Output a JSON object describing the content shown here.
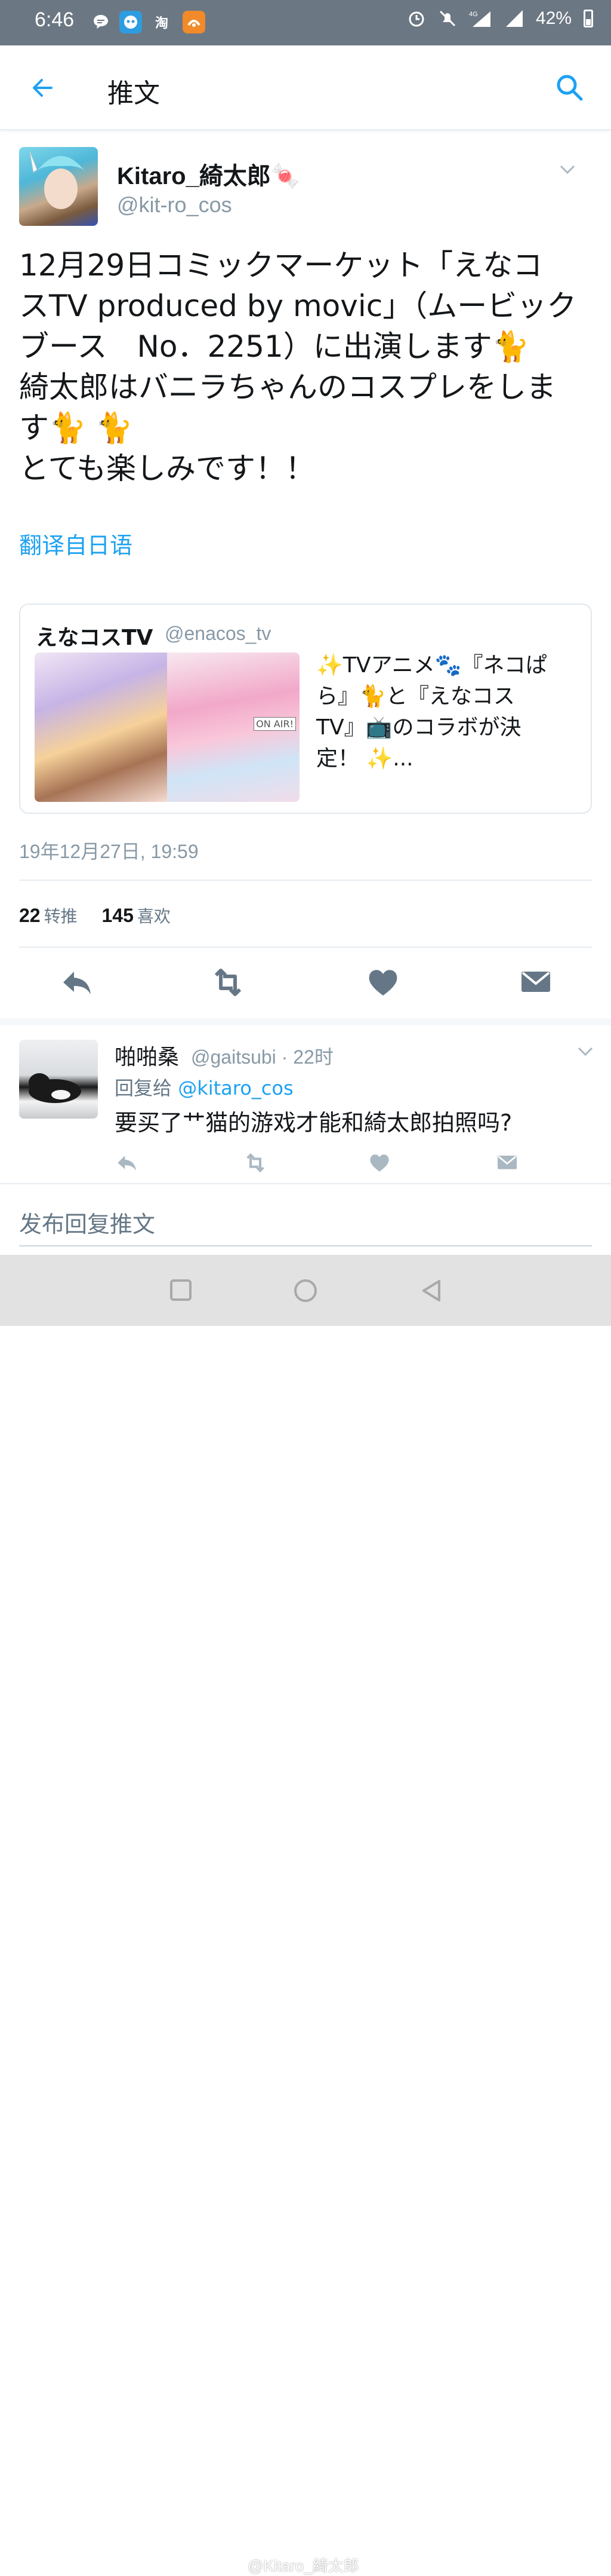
{
  "status_bar": {
    "time": "6:46",
    "app_icons": [
      "message-icon",
      "bot-icon",
      "taobao-icon",
      "uc-icon"
    ],
    "taobao_label": "淘",
    "network": "4G",
    "battery": "42%"
  },
  "appbar": {
    "title": "推文"
  },
  "tweet": {
    "author_name": "Kitaro_綺太郎🍬",
    "author_handle": "@kit-ro_cos",
    "text": "12月29日コミックマーケット「えなコ\nスTV produced by movic」（ムービック\nブース　No．2251）に出演します🐈\n綺太郎はバニラちゃんのコスプレをしま\nす🐈 🐈\nとても楽しみです！！",
    "translate_link": "翻译自日语",
    "quote": {
      "name": "えなコスTV",
      "handle": "@enacos_tv",
      "text": "✨TVアニメ🐾『ネコぱ\nら』🐈と『えなコス\nTV』📺のコラボが決\n定！ ✨...",
      "image_caption": "ON AIR!"
    },
    "timestamp": "19年12月27日, 19:59",
    "retweets_count": "22",
    "retweets_label": "转推",
    "likes_count": "145",
    "likes_label": "喜欢"
  },
  "reply": {
    "name": "啪啪桑",
    "handle": "@gaitsubi · 22时",
    "reply_to_label": "回复给",
    "reply_to_handle": "@kitaro_cos",
    "text": "要买了艹猫的游戏才能和綺太郎拍照吗?"
  },
  "compose": {
    "placeholder": "发布回复推文"
  },
  "watermark": "@Kitaro_綺太郎",
  "colors": {
    "accent": "#1da1f2",
    "status_bar": "#6b7783",
    "secondary_text": "#8899a6"
  }
}
